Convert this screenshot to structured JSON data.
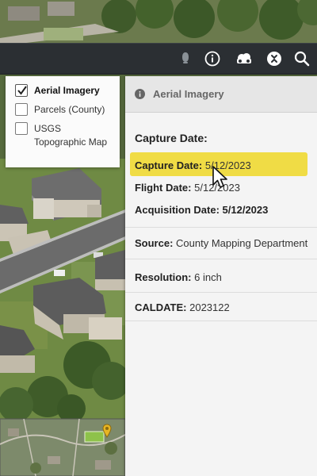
{
  "toolbar": {
    "buttons": [
      {
        "name": "location-pin",
        "icon": "map-pin-icon"
      },
      {
        "name": "info",
        "icon": "info-circle-icon"
      },
      {
        "name": "layers",
        "icon": "cloud-layers-icon"
      },
      {
        "name": "navigate",
        "icon": "compass-icon"
      },
      {
        "name": "search",
        "icon": "search-icon"
      }
    ]
  },
  "layers": {
    "items": [
      {
        "label": "Aerial Imagery",
        "checked": true
      },
      {
        "label": "Parcels (County)",
        "checked": false
      },
      {
        "label": "USGS Topographic Map",
        "checked": false
      }
    ]
  },
  "popup": {
    "title": "Aerial Imagery",
    "section_title": "Capture Date:",
    "fields": {
      "capture_date": {
        "key": "Capture Date:",
        "value": "5/12/2023"
      },
      "flight_date": {
        "key": "Flight Date:",
        "value": "5/12/2023"
      },
      "acquisition_date": {
        "key": "Acquisition Date:",
        "value": "5/12/2023"
      },
      "source": {
        "key": "Source:",
        "value": "County Mapping Department"
      },
      "resolution": {
        "key": "Resolution:",
        "value": "6 inch"
      },
      "caldate": {
        "key": "CALDATE:",
        "value": "2023122"
      }
    }
  },
  "colors": {
    "highlight": "#f0dc45",
    "toolbar": "#2b2f33",
    "marker": "#e7b524"
  }
}
